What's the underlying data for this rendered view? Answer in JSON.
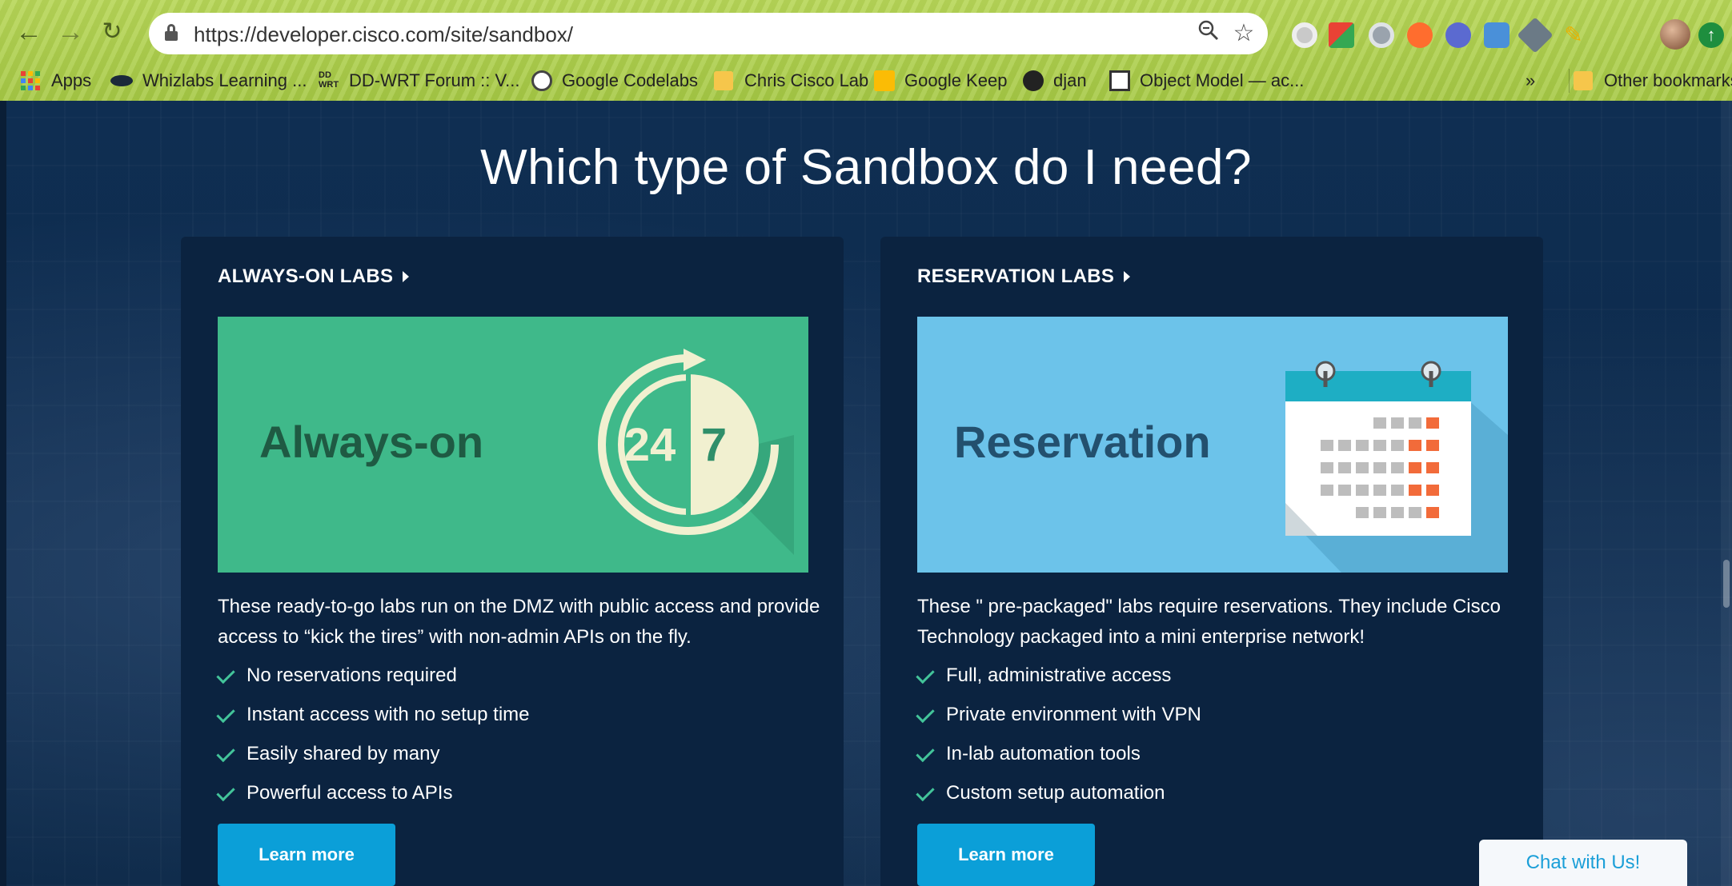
{
  "browser": {
    "url": "https://developer.cisco.com/site/sandbox/",
    "bookmarks": [
      {
        "label": "Apps",
        "icon": "apps-grid-icon"
      },
      {
        "label": "Whizlabs Learning ...",
        "icon": "whizlabs-icon"
      },
      {
        "label": "DD-WRT Forum :: V...",
        "icon": "ddwrt-icon"
      },
      {
        "label": "Google Codelabs",
        "icon": "codelabs-icon"
      },
      {
        "label": "Chris Cisco Lab",
        "icon": "folder-icon"
      },
      {
        "label": "Google Keep",
        "icon": "keep-icon"
      },
      {
        "label": "djan",
        "icon": "python-icon"
      },
      {
        "label": "Object Model — ac...",
        "icon": "document-icon"
      }
    ],
    "overflow_label": "»",
    "other_bookmarks": "Other bookmarks"
  },
  "page": {
    "heading": "Which type of Sandbox do I need?",
    "cards": [
      {
        "title": "ALWAYS-ON LABS",
        "banner_text": "Always-on",
        "banner_badge_left": "24",
        "banner_badge_right": "7",
        "description": "These ready-to-go labs run on the DMZ with public access and provide access to “kick the tires” with non-admin APIs on the fly.",
        "features": [
          "No reservations required",
          "Instant access with no setup time",
          "Easily shared by many",
          "Powerful access to APIs"
        ],
        "button": "Learn more"
      },
      {
        "title": "RESERVATION LABS",
        "banner_text": "Reservation",
        "description": "These \" pre-packaged\"  labs require reservations. They include Cisco Technology packaged into a mini enterprise network!",
        "features": [
          "Full, administrative access",
          "Private environment with VPN",
          "In-lab automation tools",
          "Custom setup automation"
        ],
        "button": "Learn more"
      }
    ],
    "chat": "Chat with Us!"
  },
  "colors": {
    "always_on_banner": "#3fb98a",
    "reservation_banner": "#6cc3ea",
    "button": "#0b9fd8",
    "check": "#43c49a",
    "calendar_header": "#1eaec4",
    "calendar_highlight": "#f26b3a"
  }
}
